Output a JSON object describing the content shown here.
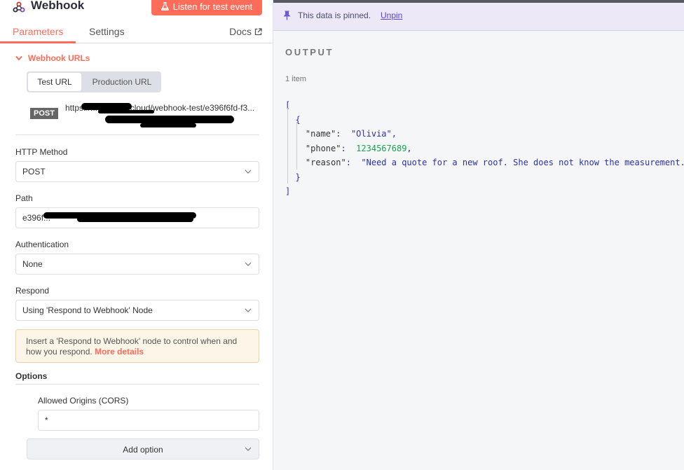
{
  "node": {
    "title": "Webhook",
    "listen_button": "Listen for test event"
  },
  "tabs": {
    "parameters": "Parameters",
    "settings": "Settings",
    "docs": "Docs"
  },
  "webhook_urls": {
    "section_label": "Webhook URLs",
    "toggle": {
      "test": "Test URL",
      "production": "Production URL",
      "selected": "Test URL"
    },
    "method_badge": "POST",
    "url_visible": "https://...app.n8n.cloud/webhook-test/e396f6fd-f3..."
  },
  "fields": {
    "http_method": {
      "label": "HTTP Method",
      "value": "POST"
    },
    "path": {
      "label": "Path",
      "value": "e396f..."
    },
    "authentication": {
      "label": "Authentication",
      "value": "None"
    },
    "respond": {
      "label": "Respond",
      "value": "Using 'Respond to Webhook' Node"
    }
  },
  "notice": {
    "text": "Insert a 'Respond to Webhook' node to control when and how you respond.",
    "link": "More details"
  },
  "options": {
    "label": "Options",
    "cors": {
      "label": "Allowed Origins (CORS)",
      "value": "*"
    },
    "add_option": "Add option"
  },
  "output": {
    "pin_notice": "This data is pinned.",
    "unpin": "Unpin",
    "title": "OUTPUT",
    "item_count": "1 item",
    "json": {
      "name": "Olivia",
      "phone": 1234567689,
      "reason": "Need a quote for a new roof. She does not know the measurement."
    }
  },
  "colors": {
    "accent": "#ff6d5a",
    "pin_bar": "#ece8f8",
    "unpin_link": "#5b3fd6",
    "json_string": "#2f2fa8",
    "json_number": "#16a34a"
  }
}
